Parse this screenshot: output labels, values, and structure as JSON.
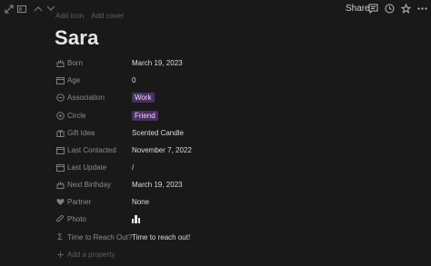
{
  "share_label": "Share",
  "ghost_actions": [
    "Add icon",
    "Add cover"
  ],
  "page_title": "Sara",
  "colors": {
    "background": "#191919",
    "tag": "#4a2f63"
  },
  "properties": [
    {
      "icon": "birthday-cake-icon",
      "label": "Born",
      "value": "March 19, 2023"
    },
    {
      "icon": "calendar-icon",
      "label": "Age",
      "value": "0"
    },
    {
      "icon": "association-icon",
      "label": "Association",
      "value": "Work",
      "tag": true
    },
    {
      "icon": "circle-icon",
      "label": "Circle",
      "value": "Friend",
      "tag": true
    },
    {
      "icon": "gift-icon",
      "label": "Gift Idea",
      "value": "Scented Candle"
    },
    {
      "icon": "calendar-icon",
      "label": "Last Contacted",
      "value": "November 7, 2022"
    },
    {
      "icon": "calendar-icon",
      "label": "Last Update",
      "value": "/"
    },
    {
      "icon": "birthday-cake-icon",
      "label": "Next Birthday",
      "value": "March 19, 2023"
    },
    {
      "icon": "heart-icon",
      "label": "Partner",
      "value": "None"
    },
    {
      "icon": "paperclip-icon",
      "label": "Photo",
      "value": ""
    },
    {
      "icon": "sigma-icon",
      "label": "Time to Reach Out?",
      "value": "Time to reach out!"
    }
  ],
  "add_property_label": "Add a property"
}
